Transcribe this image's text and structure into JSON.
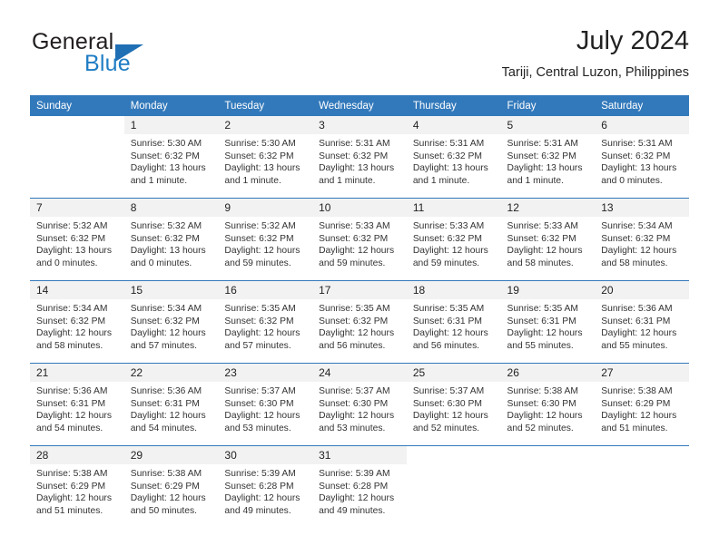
{
  "brand": {
    "word1": "General",
    "word2": "Blue",
    "triangle_color": "#1f6fb5",
    "blue_color": "#1f7dc4"
  },
  "header": {
    "title": "July 2024",
    "subtitle": "Tariji, Central Luzon, Philippines"
  },
  "theme": {
    "header_bg": "#3279bb",
    "row_divider": "#3279bb",
    "daynum_bg": "#f2f2f2"
  },
  "weekday_headers": [
    "Sunday",
    "Monday",
    "Tuesday",
    "Wednesday",
    "Thursday",
    "Friday",
    "Saturday"
  ],
  "weeks": [
    [
      {
        "day": "",
        "sunrise": "",
        "sunset": "",
        "daylight1": "",
        "daylight2": ""
      },
      {
        "day": "1",
        "sunrise": "Sunrise: 5:30 AM",
        "sunset": "Sunset: 6:32 PM",
        "daylight1": "Daylight: 13 hours",
        "daylight2": "and 1 minute."
      },
      {
        "day": "2",
        "sunrise": "Sunrise: 5:30 AM",
        "sunset": "Sunset: 6:32 PM",
        "daylight1": "Daylight: 13 hours",
        "daylight2": "and 1 minute."
      },
      {
        "day": "3",
        "sunrise": "Sunrise: 5:31 AM",
        "sunset": "Sunset: 6:32 PM",
        "daylight1": "Daylight: 13 hours",
        "daylight2": "and 1 minute."
      },
      {
        "day": "4",
        "sunrise": "Sunrise: 5:31 AM",
        "sunset": "Sunset: 6:32 PM",
        "daylight1": "Daylight: 13 hours",
        "daylight2": "and 1 minute."
      },
      {
        "day": "5",
        "sunrise": "Sunrise: 5:31 AM",
        "sunset": "Sunset: 6:32 PM",
        "daylight1": "Daylight: 13 hours",
        "daylight2": "and 1 minute."
      },
      {
        "day": "6",
        "sunrise": "Sunrise: 5:31 AM",
        "sunset": "Sunset: 6:32 PM",
        "daylight1": "Daylight: 13 hours",
        "daylight2": "and 0 minutes."
      }
    ],
    [
      {
        "day": "7",
        "sunrise": "Sunrise: 5:32 AM",
        "sunset": "Sunset: 6:32 PM",
        "daylight1": "Daylight: 13 hours",
        "daylight2": "and 0 minutes."
      },
      {
        "day": "8",
        "sunrise": "Sunrise: 5:32 AM",
        "sunset": "Sunset: 6:32 PM",
        "daylight1": "Daylight: 13 hours",
        "daylight2": "and 0 minutes."
      },
      {
        "day": "9",
        "sunrise": "Sunrise: 5:32 AM",
        "sunset": "Sunset: 6:32 PM",
        "daylight1": "Daylight: 12 hours",
        "daylight2": "and 59 minutes."
      },
      {
        "day": "10",
        "sunrise": "Sunrise: 5:33 AM",
        "sunset": "Sunset: 6:32 PM",
        "daylight1": "Daylight: 12 hours",
        "daylight2": "and 59 minutes."
      },
      {
        "day": "11",
        "sunrise": "Sunrise: 5:33 AM",
        "sunset": "Sunset: 6:32 PM",
        "daylight1": "Daylight: 12 hours",
        "daylight2": "and 59 minutes."
      },
      {
        "day": "12",
        "sunrise": "Sunrise: 5:33 AM",
        "sunset": "Sunset: 6:32 PM",
        "daylight1": "Daylight: 12 hours",
        "daylight2": "and 58 minutes."
      },
      {
        "day": "13",
        "sunrise": "Sunrise: 5:34 AM",
        "sunset": "Sunset: 6:32 PM",
        "daylight1": "Daylight: 12 hours",
        "daylight2": "and 58 minutes."
      }
    ],
    [
      {
        "day": "14",
        "sunrise": "Sunrise: 5:34 AM",
        "sunset": "Sunset: 6:32 PM",
        "daylight1": "Daylight: 12 hours",
        "daylight2": "and 58 minutes."
      },
      {
        "day": "15",
        "sunrise": "Sunrise: 5:34 AM",
        "sunset": "Sunset: 6:32 PM",
        "daylight1": "Daylight: 12 hours",
        "daylight2": "and 57 minutes."
      },
      {
        "day": "16",
        "sunrise": "Sunrise: 5:35 AM",
        "sunset": "Sunset: 6:32 PM",
        "daylight1": "Daylight: 12 hours",
        "daylight2": "and 57 minutes."
      },
      {
        "day": "17",
        "sunrise": "Sunrise: 5:35 AM",
        "sunset": "Sunset: 6:32 PM",
        "daylight1": "Daylight: 12 hours",
        "daylight2": "and 56 minutes."
      },
      {
        "day": "18",
        "sunrise": "Sunrise: 5:35 AM",
        "sunset": "Sunset: 6:31 PM",
        "daylight1": "Daylight: 12 hours",
        "daylight2": "and 56 minutes."
      },
      {
        "day": "19",
        "sunrise": "Sunrise: 5:35 AM",
        "sunset": "Sunset: 6:31 PM",
        "daylight1": "Daylight: 12 hours",
        "daylight2": "and 55 minutes."
      },
      {
        "day": "20",
        "sunrise": "Sunrise: 5:36 AM",
        "sunset": "Sunset: 6:31 PM",
        "daylight1": "Daylight: 12 hours",
        "daylight2": "and 55 minutes."
      }
    ],
    [
      {
        "day": "21",
        "sunrise": "Sunrise: 5:36 AM",
        "sunset": "Sunset: 6:31 PM",
        "daylight1": "Daylight: 12 hours",
        "daylight2": "and 54 minutes."
      },
      {
        "day": "22",
        "sunrise": "Sunrise: 5:36 AM",
        "sunset": "Sunset: 6:31 PM",
        "daylight1": "Daylight: 12 hours",
        "daylight2": "and 54 minutes."
      },
      {
        "day": "23",
        "sunrise": "Sunrise: 5:37 AM",
        "sunset": "Sunset: 6:30 PM",
        "daylight1": "Daylight: 12 hours",
        "daylight2": "and 53 minutes."
      },
      {
        "day": "24",
        "sunrise": "Sunrise: 5:37 AM",
        "sunset": "Sunset: 6:30 PM",
        "daylight1": "Daylight: 12 hours",
        "daylight2": "and 53 minutes."
      },
      {
        "day": "25",
        "sunrise": "Sunrise: 5:37 AM",
        "sunset": "Sunset: 6:30 PM",
        "daylight1": "Daylight: 12 hours",
        "daylight2": "and 52 minutes."
      },
      {
        "day": "26",
        "sunrise": "Sunrise: 5:38 AM",
        "sunset": "Sunset: 6:30 PM",
        "daylight1": "Daylight: 12 hours",
        "daylight2": "and 52 minutes."
      },
      {
        "day": "27",
        "sunrise": "Sunrise: 5:38 AM",
        "sunset": "Sunset: 6:29 PM",
        "daylight1": "Daylight: 12 hours",
        "daylight2": "and 51 minutes."
      }
    ],
    [
      {
        "day": "28",
        "sunrise": "Sunrise: 5:38 AM",
        "sunset": "Sunset: 6:29 PM",
        "daylight1": "Daylight: 12 hours",
        "daylight2": "and 51 minutes."
      },
      {
        "day": "29",
        "sunrise": "Sunrise: 5:38 AM",
        "sunset": "Sunset: 6:29 PM",
        "daylight1": "Daylight: 12 hours",
        "daylight2": "and 50 minutes."
      },
      {
        "day": "30",
        "sunrise": "Sunrise: 5:39 AM",
        "sunset": "Sunset: 6:28 PM",
        "daylight1": "Daylight: 12 hours",
        "daylight2": "and 49 minutes."
      },
      {
        "day": "31",
        "sunrise": "Sunrise: 5:39 AM",
        "sunset": "Sunset: 6:28 PM",
        "daylight1": "Daylight: 12 hours",
        "daylight2": "and 49 minutes."
      },
      {
        "day": "",
        "sunrise": "",
        "sunset": "",
        "daylight1": "",
        "daylight2": ""
      },
      {
        "day": "",
        "sunrise": "",
        "sunset": "",
        "daylight1": "",
        "daylight2": ""
      },
      {
        "day": "",
        "sunrise": "",
        "sunset": "",
        "daylight1": "",
        "daylight2": ""
      }
    ]
  ]
}
